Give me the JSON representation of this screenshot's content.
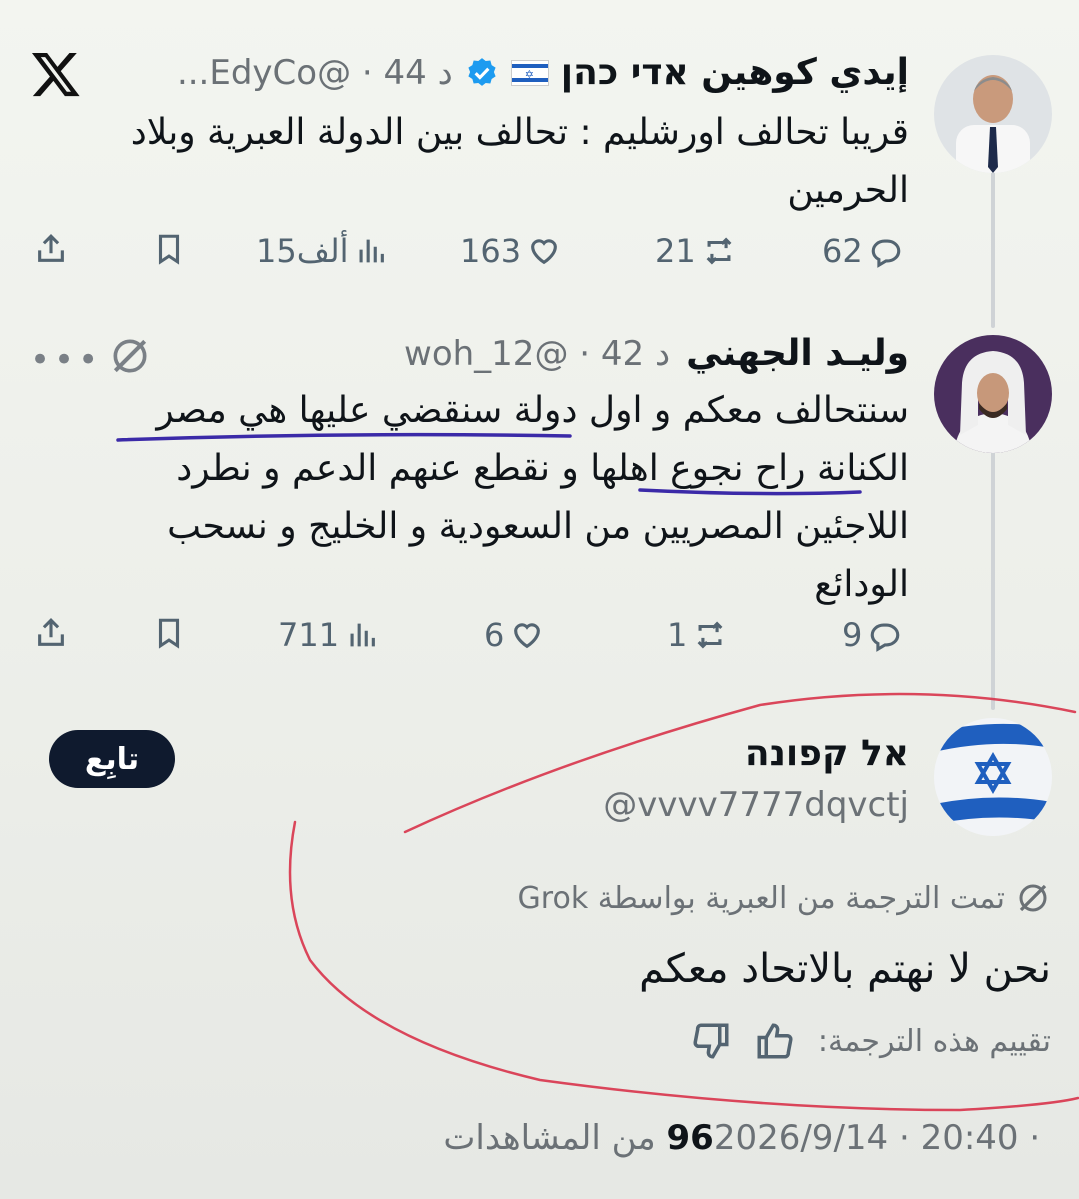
{
  "tweet1": {
    "name": "إيدي كوهين אדי כהן",
    "flag": "🇮🇱",
    "handle_time": "...EdyCo@ · 44 د",
    "text_line1": "قريبا تحالف اورشليم :  تحالف بين الدولة العبرية وبلاد",
    "text_line2": "الحرمين",
    "actions": {
      "replies": "62",
      "retweets": "21",
      "likes": "163",
      "views": "15ألف"
    }
  },
  "tweet2": {
    "name": "وليـد الجهني",
    "handle_time": "woh_12@ · 42 د",
    "text_lines": [
      "سنتحالف معكم و اول دولة سنقضي عليها هي مصر",
      "الكنانة راح نجوع اهلها و نقطع عنهم الدعم و نطرد",
      "اللاجئين المصريين من السعودية و الخليج و نسحب",
      "الودائع"
    ],
    "actions": {
      "replies": "9",
      "retweets": "1",
      "likes": "6",
      "views": "711"
    }
  },
  "tweet3": {
    "name": "אל קפונה",
    "handle": "@vvvv7777dqvctj",
    "follow_label": "تابِع",
    "grok_label": "تمت الترجمة من العبرية بواسطة Grok",
    "translated_text": "نحن لا نهتم بالاتحاد معكم",
    "rating_label": "تقييم هذه الترجمة:",
    "timestamp_prefix": "2026/9/14 · 20:40 · ",
    "views_count": "96",
    "views_suffix": " من المشاهدات"
  },
  "icons": [
    "x-logo-icon",
    "verified-badge-icon",
    "israel-flag-icon",
    "grok-icon",
    "reply-icon",
    "retweet-icon",
    "like-icon",
    "views-icon",
    "bookmark-icon",
    "share-icon",
    "more-icon",
    "thumbs-up-icon",
    "thumbs-down-icon"
  ],
  "colors": {
    "annotation_red": "#d8334a",
    "annotation_purple": "#3b2aa8",
    "verified_blue": "#1d9bf0",
    "follow_bg": "#0f1a2e"
  }
}
